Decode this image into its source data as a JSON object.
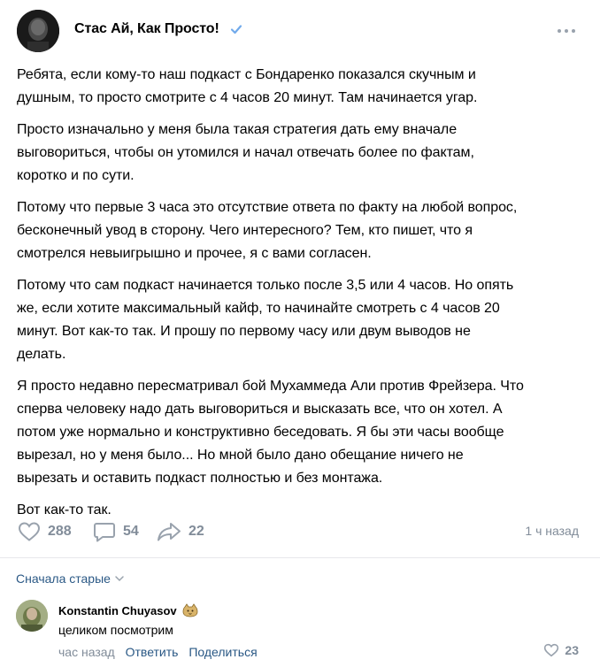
{
  "post": {
    "author": "Стас Ай, Как Просто!",
    "paragraphs": [
      [
        "Ребята, если кому-то наш подкаст с Бондаренко показался скучным и",
        "душным, то просто смотрите с 4 часов 20 минут. Там начинается угар."
      ],
      [
        "Просто изначально у меня была такая стратегия дать ему вначале",
        "выговориться, чтобы он утомился и начал отвечать более по фактам,",
        "коротко и по сути."
      ],
      [
        "Потому что первые 3 часа это отсутствие ответа по факту на любой вопрос,",
        "бесконечный увод в сторону. Чего интересного? Тем, кто пишет, что я",
        "смотрелся невыигрышно и прочее, я с вами согласен."
      ],
      [
        "Потому что сам подкаст начинается только после 3,5 или 4 часов. Но опять",
        "же, если хотите максимальный кайф, то начинайте смотреть с 4 часов 20",
        "минут. Вот как-то так. И прошу по первому часу или двум выводов не",
        "делать."
      ],
      [
        "Я просто недавно пересматривал бой Мухаммеда Али против Фрейзера. Что",
        "сперва человеку надо дать выговориться и высказать все, что он хотел. А",
        "потом уже нормально и конструктивно беседовать. Я бы эти часы вообще",
        "вырезал, но у меня было... Но мной было дано обещание ничего не",
        "вырезать и оставить подкаст полностью и без монтажа."
      ],
      [
        "Вот как-то так."
      ]
    ],
    "likes": "288",
    "comments": "54",
    "shares": "22",
    "time": "1 ч назад",
    "accent_color": "#2a5885",
    "muted_color": "#818c99",
    "verified_color": "#71aaeb"
  },
  "comments_section": {
    "sort_label": "Сначала старые",
    "comment": {
      "author": "Konstantin Chuyasov",
      "text": "целиком посмотрим",
      "time": "час назад",
      "reply_label": "Ответить",
      "share_label": "Поделиться",
      "likes": "23"
    }
  }
}
